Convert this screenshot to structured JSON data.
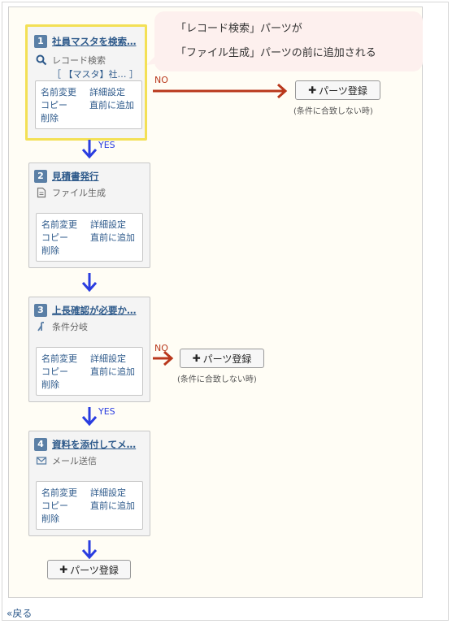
{
  "callout": {
    "line1": "「レコード検索」パーツが",
    "line2": "「ファイル生成」パーツの前に追加される"
  },
  "menu": {
    "rename": "名前変更",
    "detail": "詳細設定",
    "copy": "コピー",
    "insert_before": "直前に追加",
    "delete": "削除"
  },
  "cards": [
    {
      "number": "1",
      "title": "社員マスタを検索…",
      "type_label": "レコード検索",
      "sub_label": "［ 【マスタ】社… ］",
      "icon": "search-icon"
    },
    {
      "number": "2",
      "title": "見積書発行",
      "type_label": "ファイル生成",
      "icon": "document-icon"
    },
    {
      "number": "3",
      "title": "上長確認が必要か…",
      "type_label": "条件分岐",
      "icon": "branch-icon"
    },
    {
      "number": "4",
      "title": "資料を添付してメ…",
      "type_label": "メール送信",
      "icon": "mail-icon"
    }
  ],
  "flow": {
    "yes": "YES",
    "no": "NO"
  },
  "add_parts_label": "パーツ登録",
  "condition_note": "(条件に合致しない時)",
  "back_link": "«戻る",
  "colors": {
    "yes_arrow": "#2a3de0",
    "no_arrow": "#b9381c",
    "highlight": "#f3e055",
    "callout_bg": "#fdf0ee",
    "link": "#2e5a8b"
  }
}
